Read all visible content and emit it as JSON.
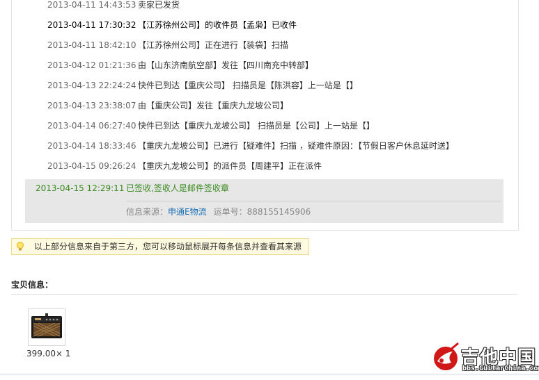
{
  "tracking": {
    "events": [
      {
        "time": "2013-04-11 14:43:53",
        "desc": "卖家已发货",
        "dark": false
      },
      {
        "time": "2013-04-11 17:30:32",
        "desc": "【江苏徐州公司】的收件员【孟枭】已收件",
        "dark": true
      },
      {
        "time": "2013-04-11 18:42:10",
        "desc": "【江苏徐州公司】正在进行【装袋】扫描",
        "dark": false
      },
      {
        "time": "2013-04-12 01:21:36",
        "desc": "由【山东济南航空部】发往【四川南充中转部】",
        "dark": false
      },
      {
        "time": "2013-04-13 22:24:24",
        "desc": "快件已到达【重庆公司】 扫描员是【陈洪容】上一站是【】",
        "dark": false
      },
      {
        "time": "2013-04-13 23:38:07",
        "desc": "由【重庆公司】发往【重庆九龙坡公司】",
        "dark": false
      },
      {
        "time": "2013-04-14 06:27:40",
        "desc": "快件已到达【重庆九龙坡公司】 扫描员是【公司】上一站是【】",
        "dark": false
      },
      {
        "time": "2013-04-14 18:33:46",
        "desc": "【重庆九龙坡公司】已进行【疑难件】扫描 ，疑难件原因：【节假日客户休息延时送】",
        "dark": false
      },
      {
        "time": "2013-04-15 09:26:24",
        "desc": "【重庆九龙坡公司】的派件员【周建平】正在派件",
        "dark": false
      }
    ],
    "latest": {
      "time": "2013-04-15 12:29:11",
      "desc": "已签收,签收人是邮件签收章"
    },
    "source_label": "信息来源：",
    "source_link": "申通E物流",
    "waybill_label": "运单号：",
    "waybill_no": "888155145906"
  },
  "notice": {
    "text": "以上部分信息来自于第三方，您可以移动鼠标展开每条信息并查看其来源",
    "icon": "lightbulb-icon"
  },
  "item_section": {
    "title": "宝贝信息：",
    "price": "399.00× 1"
  },
  "watermark": {
    "brand": "吉他中国",
    "url": "bbs.GuitarChina.com"
  },
  "colors": {
    "green": "#3a8a1f",
    "link": "#1a6fb5",
    "highlight_bg": "#e7e7e7",
    "notice_bg": "#fffbe0"
  }
}
